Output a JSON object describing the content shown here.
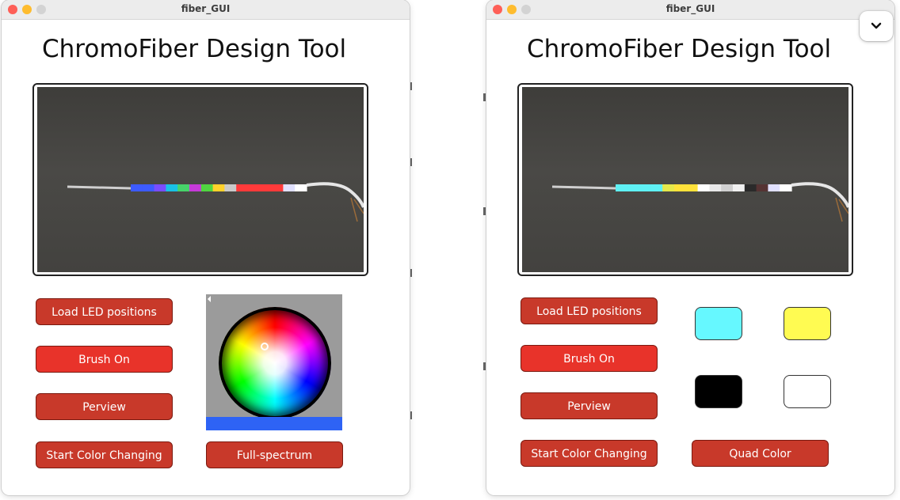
{
  "windows": [
    {
      "title": "fiber_GUI",
      "app_title": "ChromoFiber Design Tool",
      "buttons": {
        "load": "Load LED positions",
        "brush": "Brush On",
        "preview": "Perview",
        "start": "Start Color Changing",
        "mode": "Full-spectrum"
      },
      "wheel_bar_color": "#2e63f5",
      "fiber_colors": [
        "#3d5bff",
        "#3d5bff",
        "#7a4dff",
        "#19c1e6",
        "#47d36a",
        "#c63bd8",
        "#50d640",
        "#ffd12a",
        "#c9c9c9",
        "#ff3a3a",
        "#ff3a3a",
        "#ff3a3a",
        "#ff3a3a",
        "#e0e0ff",
        "#ffffff"
      ]
    },
    {
      "title": "fiber_GUI",
      "app_title": "ChromoFiber Design Tool",
      "buttons": {
        "load": "Load LED positions",
        "brush": "Brush On",
        "preview": "Perview",
        "start": "Start Color Changing",
        "mode": "Quad Color"
      },
      "swatches": [
        "#66f8ff",
        "#fffb52",
        "#000000",
        "#ffffff"
      ],
      "fiber_colors": [
        "#5ff1f4",
        "#5ff1f4",
        "#5ff1f4",
        "#5ff1f4",
        "#e5e84a",
        "#ffe23a",
        "#ffe23a",
        "#ffffff",
        "#e8e8e8",
        "#d0d0d0",
        "#f0f0f0",
        "#2a2a2a",
        "#553333",
        "#e0e0ff",
        "#ffffff"
      ]
    }
  ],
  "overlay": {
    "chevron_icon": "chevron-down-icon"
  }
}
